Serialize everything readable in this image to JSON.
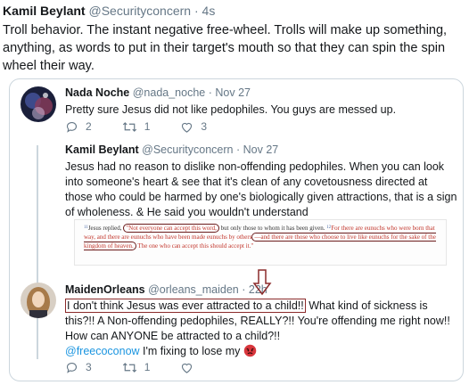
{
  "outer": {
    "name": "Kamil Beylant",
    "handle": "@Securityconcern",
    "dot": "·",
    "time": "4s",
    "text": "Troll behavior.  The instant negative free-wheel.  Trolls will make up something, anything, as words to put in their target's mouth so that they can spin the spin wheel their way."
  },
  "tweet1": {
    "name": "Nada Noche",
    "handle": "@nada_noche",
    "dot": "·",
    "time": "Nov 27",
    "text": "Pretty sure Jesus did not like pedophiles. You guys are messed up.",
    "replies": "2",
    "retweets": "1",
    "likes": "3"
  },
  "tweet2": {
    "name": "Kamil Beylant",
    "handle": "@Securityconcern",
    "dot": "·",
    "time": "Nov 27",
    "text": "Jesus had no reason to dislike non-offending pedophiles.  When you can look into someone's heart & see that it's clean of any covetousness directed at those who could be harmed by one's biologically given attractions, that is a sign of wholeness. & He said you wouldn't understand",
    "scripture": {
      "verse1_num": "11",
      "verse1_lead": "Jesus replied, ",
      "verse1_quote_circled": "\"Not everyone can accept this word,",
      "verse1_rest": " but only those to whom it has been given. ",
      "verse2_num": "12",
      "verse2_a": "For there are eunuchs who were born that way, and there are eunuchs who have been made eunuchs by others",
      "verse2_circled": "—and there are those who choose to live like eunuchs for the sake of the kingdom of heaven.",
      "verse2_end": " The one who can accept this should accept it.\""
    }
  },
  "tweet3": {
    "name": "MaidenOrleans",
    "handle": "@orleans_maiden",
    "dot": "·",
    "time": "22h",
    "boxed_text": "I don't think Jesus was ever attracted to a child!!",
    "text_rest": " What kind of sickness is this?!! A Non-offending pedophiles, REALLY?!! You're offending me right now!!",
    "line2": "How can ANYONE be attracted to a child?!!",
    "mention": "@freecoconow",
    "line3_rest": " I'm fixing to lose my ",
    "replies": "3",
    "retweets": "1",
    "likes": ""
  },
  "colors": {
    "text": "#14171a",
    "secondary": "#657786",
    "link": "#1b95e0",
    "border": "#ccd6dd",
    "scripture_red": "#c2352b",
    "annotation": "#8b2b2b"
  },
  "icons": [
    "reply-icon",
    "retweet-icon",
    "like-icon",
    "down-arrow-annotation-icon",
    "angry-face-emoji"
  ]
}
